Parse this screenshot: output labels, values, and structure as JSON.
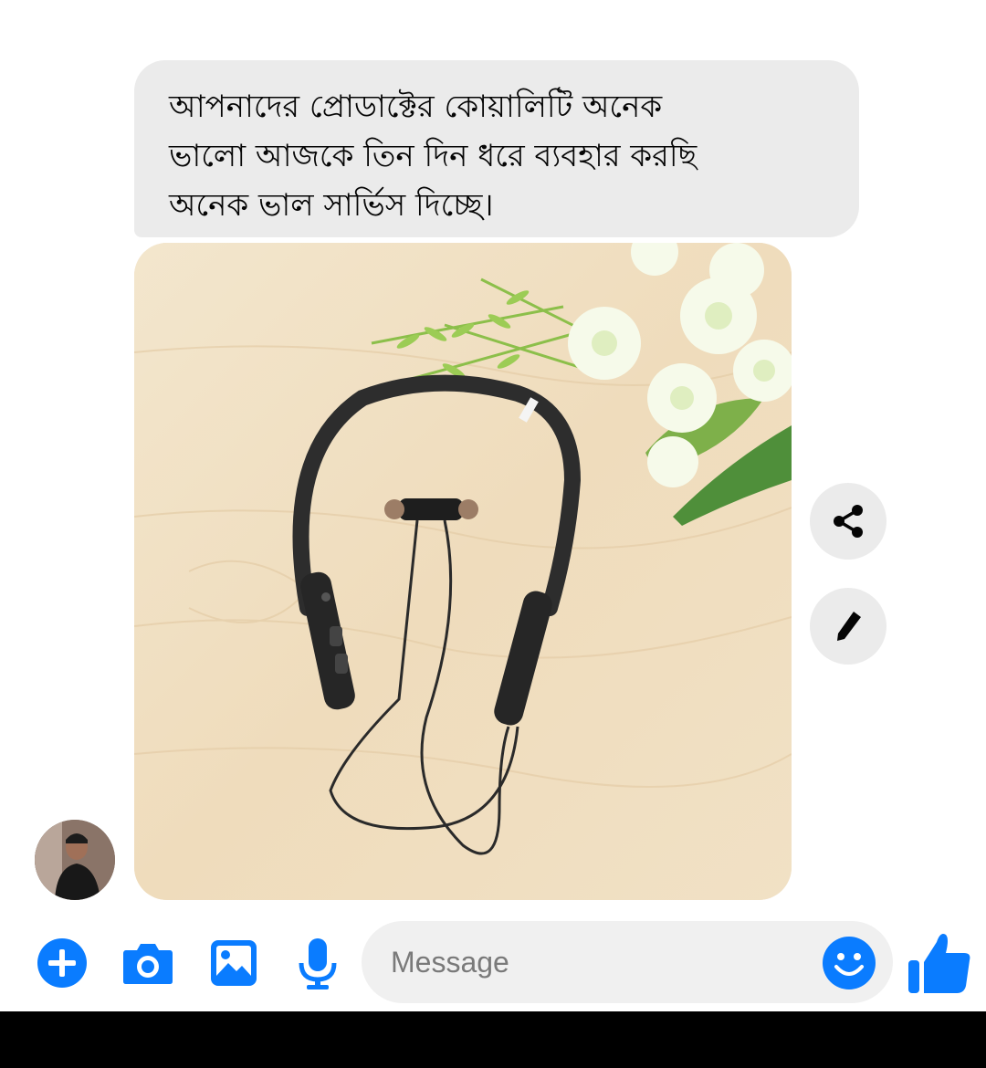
{
  "message": {
    "lines": [
      "আপনাদের প্রোডাক্টের কোয়ালিটি অনেক",
      "ভালো আজকে তিন দিন ধরে ব্যবহার করছি",
      "অনেক ভাল সার্ভিস দিচ্ছে।"
    ]
  },
  "attachment": {
    "subject": "black neckband bluetooth earphones on light wood surface with white flowers"
  },
  "actions": {
    "share_icon": "share-icon",
    "edit_icon": "pencil-icon"
  },
  "composer": {
    "placeholder": "Message",
    "icons": [
      "plus-circle-icon",
      "camera-icon",
      "image-icon",
      "microphone-icon",
      "emoji-icon",
      "thumbs-up-icon"
    ]
  },
  "colors": {
    "accent": "#0a7cff",
    "bubble": "#ebebeb"
  }
}
